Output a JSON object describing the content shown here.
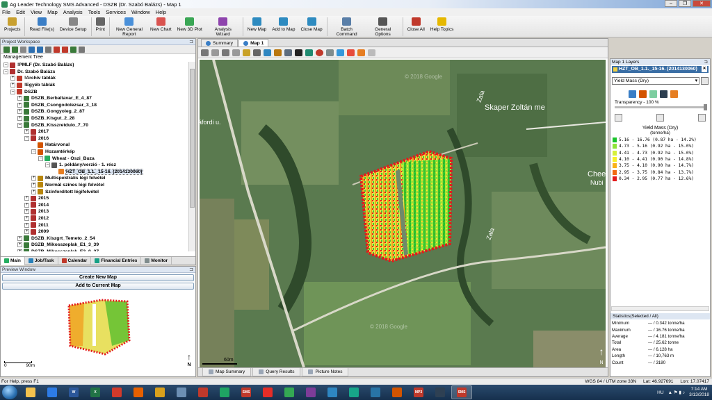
{
  "window": {
    "title": "Ag Leader Technology SMS Advanced - DSZB (Dr. Szabó Balázs) - Map 1",
    "buttons": [
      "–",
      "❐",
      "✕"
    ]
  },
  "menu": [
    "File",
    "Edit",
    "View",
    "Map",
    "Analysis",
    "Tools",
    "Services",
    "Window",
    "Help"
  ],
  "toolbar": [
    {
      "label": "Projects",
      "icon": "projects-icon",
      "color": "#c8a030"
    },
    {
      "label": "Read File(s)",
      "icon": "read-files-icon",
      "color": "#3a7ec6"
    },
    {
      "label": "Device Setup",
      "icon": "device-setup-icon",
      "color": "#888888"
    },
    {
      "label": "Print",
      "icon": "print-icon",
      "color": "#666666"
    },
    {
      "label": "New General Report",
      "icon": "report-icon",
      "color": "#4a90d9"
    },
    {
      "label": "New Chart",
      "icon": "chart-icon",
      "color": "#d9534f"
    },
    {
      "label": "New 3D Plot",
      "icon": "3d-plot-icon",
      "color": "#3aa655"
    },
    {
      "label": "Analysis Wizard",
      "icon": "wizard-icon",
      "color": "#8e44ad"
    },
    {
      "label": "New Map",
      "icon": "new-map-icon",
      "color": "#2e8bc0"
    },
    {
      "label": "Add to Map",
      "icon": "add-to-map-icon",
      "color": "#2e8bc0"
    },
    {
      "label": "Close Map",
      "icon": "close-map-icon",
      "color": "#2e8bc0"
    },
    {
      "label": "Batch Command",
      "icon": "batch-icon",
      "color": "#5a7fa8"
    },
    {
      "label": "General Options",
      "icon": "options-icon",
      "color": "#555555"
    },
    {
      "label": "Close All",
      "icon": "close-all-icon",
      "color": "#c0392b"
    },
    {
      "label": "Help Topics",
      "icon": "help-icon",
      "color": "#e6b800"
    }
  ],
  "workspace": {
    "title": "Project Workspace",
    "tree_title": "Management Tree",
    "tree": [
      {
        "indent": 0,
        "exp": "–",
        "label": "!PMLF (Dr. Szabó Balázs)",
        "color": "#b03030",
        "bold": true
      },
      {
        "indent": 0,
        "exp": "–",
        "label": "Dr. Szabó Balázs",
        "color": "#b03030",
        "bold": true
      },
      {
        "indent": 1,
        "exp": "+",
        "label": "!Archív táblák",
        "color": "#c0392b",
        "bold": true
      },
      {
        "indent": 1,
        "exp": "+",
        "label": "!Egyéb táblák",
        "color": "#c0392b",
        "bold": true
      },
      {
        "indent": 1,
        "exp": "–",
        "label": "DSZB",
        "color": "#c0392b",
        "bold": true
      },
      {
        "indent": 2,
        "exp": "+",
        "label": "DSZB_Berbaltavar_E_4_87",
        "color": "#3a7a3a",
        "bold": true
      },
      {
        "indent": 2,
        "exp": "+",
        "label": "DSZB_Csongodolezsar_3_18",
        "color": "#3a7a3a",
        "bold": true
      },
      {
        "indent": 2,
        "exp": "+",
        "label": "DSZB_Gongyoleg_2_87",
        "color": "#3a7a3a",
        "bold": true
      },
      {
        "indent": 2,
        "exp": "+",
        "label": "DSZB_Kisgut_2_28",
        "color": "#3a7a3a",
        "bold": true
      },
      {
        "indent": 2,
        "exp": "–",
        "label": "DSZB_Kisszretdulo_7_70",
        "color": "#3a7a3a",
        "bold": true
      },
      {
        "indent": 3,
        "exp": "+",
        "label": "2017",
        "color": "#b03030",
        "bold": true
      },
      {
        "indent": 3,
        "exp": "–",
        "label": "2016",
        "color": "#b03030",
        "bold": true
      },
      {
        "indent": 4,
        "exp": "",
        "label": "Határvonal",
        "color": "#d35400",
        "bold": true
      },
      {
        "indent": 4,
        "exp": "–",
        "label": "Hozamtérkép",
        "color": "#d35400",
        "bold": true
      },
      {
        "indent": 5,
        "exp": "–",
        "label": "Wheat - Oszi_Buza",
        "color": "#27ae60",
        "bold": true
      },
      {
        "indent": 6,
        "exp": "–",
        "label": "1. példány/verzió - 1. rész",
        "color": "#555555",
        "bold": true
      },
      {
        "indent": 7,
        "exp": "",
        "label": "HZT_OB_1.1._15-16. (2014130060)",
        "color": "#e67e22",
        "bold": true,
        "selected": true
      },
      {
        "indent": 4,
        "exp": "+",
        "label": "Multispektrális légi felvétel",
        "color": "#b8860b",
        "bold": true
      },
      {
        "indent": 4,
        "exp": "+",
        "label": "Normál színes légi felvétel",
        "color": "#b8860b",
        "bold": true
      },
      {
        "indent": 4,
        "exp": "+",
        "label": "Színfordított légifelvétel",
        "color": "#b8860b",
        "bold": true
      },
      {
        "indent": 3,
        "exp": "+",
        "label": "2015",
        "color": "#b03030",
        "bold": true
      },
      {
        "indent": 3,
        "exp": "+",
        "label": "2014",
        "color": "#b03030",
        "bold": true
      },
      {
        "indent": 3,
        "exp": "+",
        "label": "2013",
        "color": "#b03030",
        "bold": true
      },
      {
        "indent": 3,
        "exp": "+",
        "label": "2012",
        "color": "#b03030",
        "bold": true
      },
      {
        "indent": 3,
        "exp": "+",
        "label": "2011",
        "color": "#b03030",
        "bold": true
      },
      {
        "indent": 3,
        "exp": "+",
        "label": "2009",
        "color": "#b03030",
        "bold": true
      },
      {
        "indent": 2,
        "exp": "+",
        "label": "DSZB_Kiszgrt_Temeto_2_54",
        "color": "#3a7a3a",
        "bold": true
      },
      {
        "indent": 2,
        "exp": "+",
        "label": "DSZB_Mikosszeplak_E1_3_39",
        "color": "#3a7a3a",
        "bold": true
      },
      {
        "indent": 2,
        "exp": "+",
        "label": "DSZB_Mikosszeplak_E2_0_27",
        "color": "#3a7a3a",
        "bold": true
      }
    ],
    "tabs": [
      {
        "label": "Main",
        "color": "#27ae60",
        "active": true
      },
      {
        "label": "Job/Task",
        "color": "#2980b9"
      },
      {
        "label": "Calendar",
        "color": "#c0392b"
      },
      {
        "label": "Financial Entries",
        "color": "#16a085"
      },
      {
        "label": "Monitor",
        "color": "#7f8c8d"
      }
    ]
  },
  "preview": {
    "title": "Preview Window",
    "create_btn": "Create New Map",
    "add_btn": "Add to Current Map",
    "scale_left": "0",
    "scale_right": "90m",
    "north": "N"
  },
  "map": {
    "tabs": [
      {
        "label": "Summary",
        "active": false
      },
      {
        "label": "Map 1",
        "active": true
      }
    ],
    "labels": {
      "zala1": "Zala",
      "zala2": "Zala",
      "street": "Skaper Zoltán me",
      "cheese": "Chees",
      "nubi": "Nubi",
      "forditu": "áfordi u.",
      "scale": "60m",
      "google1": "© 2018 Google",
      "google2": "© 2018 Google",
      "north": "N"
    },
    "bottom_tabs": [
      "Map Summary",
      "Query Results",
      "Picture Notes"
    ]
  },
  "layers": {
    "title": "Map 1 Layers",
    "layer_name": "HZT_OB_1.1._15-16. (2014130060)",
    "attribute": "Yield Mass (Dry)",
    "transparency": "Transparency - 100 %",
    "legend_title": "Yield Mass (Dry)",
    "legend_unit": "(tonne/ha)",
    "legend": [
      {
        "text": "5.16 - 16.76 (0.87 ha - 14.2%)",
        "color": "#19c42b"
      },
      {
        "text": "4.73 - 5.16 (0.92 ha - 15.0%)",
        "color": "#8ee43a"
      },
      {
        "text": "4.41 - 4.73 (0.92 ha - 15.0%)",
        "color": "#d6f03a"
      },
      {
        "text": "4.10 - 4.41 (0.90 ha - 14.8%)",
        "color": "#f7f028"
      },
      {
        "text": "3.75 - 4.10 (0.90 ha - 14.7%)",
        "color": "#f9b21c"
      },
      {
        "text": "2.95 - 3.75 (0.84 ha - 13.7%)",
        "color": "#f26a12"
      },
      {
        "text": "0.34 - 2.95 (0.77 ha - 12.6%)",
        "color": "#e31a1c"
      }
    ],
    "stats_title": "Statistics(Selected / All)",
    "stats": [
      {
        "k": "Minimum",
        "v": "--- / 0.342 tonne/ha"
      },
      {
        "k": "Maximum",
        "v": "--- / 16.76 tonne/ha"
      },
      {
        "k": "Average",
        "v": "--- / 4.181 tonne/ha"
      },
      {
        "k": "Total",
        "v": "--- / 25.62 tonne"
      },
      {
        "k": "Area",
        "v": "--- / 6.128 ha"
      },
      {
        "k": "Length",
        "v": "--- / 10,763 m"
      },
      {
        "k": "Count",
        "v": "--- / 3180"
      }
    ]
  },
  "status": {
    "help": "For Help, press F1",
    "datum": "WGS 84 / UTM zone 33N",
    "lat": "Lat: 46.927691",
    "lon": "Lon: 17.07417"
  },
  "taskbar": {
    "apps": [
      {
        "icon": "explorer-icon",
        "color": "#f2c14e",
        "text": ""
      },
      {
        "icon": "dropbox-icon",
        "color": "#2d7be5",
        "text": ""
      },
      {
        "icon": "word-icon",
        "color": "#2b579a",
        "text": "W"
      },
      {
        "icon": "excel-icon",
        "color": "#217346",
        "text": "X"
      },
      {
        "icon": "acrobat-icon",
        "color": "#d13a2b",
        "text": ""
      },
      {
        "icon": "firefox-icon",
        "color": "#e66000",
        "text": ""
      },
      {
        "icon": "chrome-icon",
        "color": "#d8a01c",
        "text": ""
      },
      {
        "icon": "app-icon",
        "color": "#6c8fb3",
        "text": ""
      },
      {
        "icon": "mail-icon",
        "color": "#c0392b",
        "text": ""
      },
      {
        "icon": "drive-icon",
        "color": "#1fa463",
        "text": ""
      },
      {
        "icon": "sms-icon",
        "color": "#c0392b",
        "text": "SMS"
      },
      {
        "icon": "youtube-icon",
        "color": "#e52d27",
        "text": ""
      },
      {
        "icon": "maps-icon",
        "color": "#34a853",
        "text": ""
      },
      {
        "icon": "app2-icon",
        "color": "#7d3c98",
        "text": ""
      },
      {
        "icon": "app3-icon",
        "color": "#2e86c1",
        "text": ""
      },
      {
        "icon": "app4-icon",
        "color": "#17a589",
        "text": ""
      },
      {
        "icon": "app5-icon",
        "color": "#2874a6",
        "text": ""
      },
      {
        "icon": "app6-icon",
        "color": "#d35400",
        "text": ""
      },
      {
        "icon": "mp3-icon",
        "color": "#c0392b",
        "text": "MP3"
      },
      {
        "icon": "app7-icon",
        "color": "#2e4053",
        "text": ""
      },
      {
        "icon": "sms-active-icon",
        "color": "#c0392b",
        "text": "SMS"
      }
    ],
    "lang": "HU",
    "time": "7:14 AM",
    "date": "3/13/2018"
  }
}
